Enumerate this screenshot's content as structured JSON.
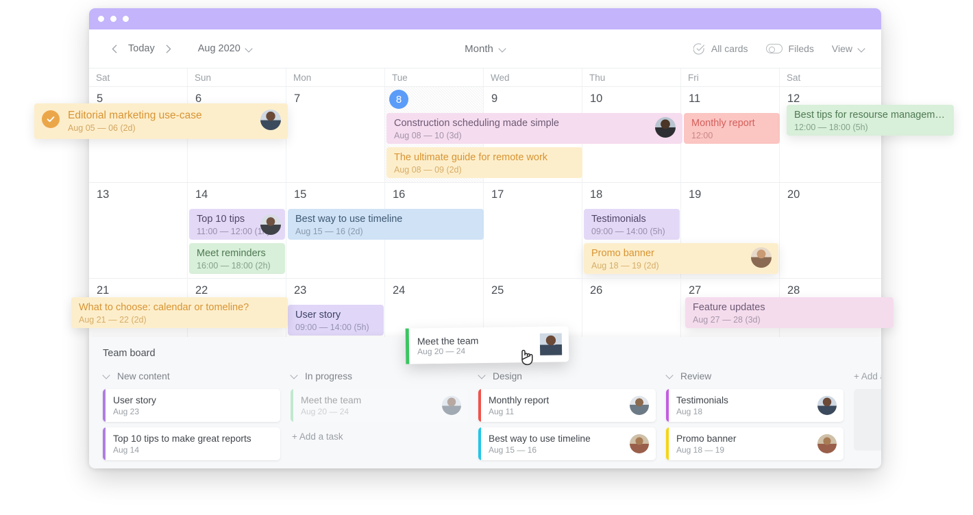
{
  "window": {
    "dots": 3
  },
  "toolbar": {
    "prev_label": "‹",
    "today_label": "Today",
    "next_label": "›",
    "month_label": "Aug 2020",
    "view_label": "Month",
    "all_cards_label": "All cards",
    "fields_label": "Fileds",
    "view_menu_label": "View"
  },
  "calendar": {
    "daynames": [
      "Sat",
      "Sun",
      "Mon",
      "Tue",
      "Wed",
      "Thu",
      "Fri",
      "Sat"
    ],
    "today_day": "8",
    "weeks": [
      {
        "days": [
          "5",
          "6",
          "7",
          "8",
          "9",
          "10",
          "11",
          "12"
        ]
      },
      {
        "days": [
          "13",
          "14",
          "15",
          "16",
          "17",
          "18",
          "19",
          "20"
        ]
      },
      {
        "days": [
          "21",
          "22",
          "23",
          "24",
          "25",
          "26",
          "27",
          "28"
        ]
      }
    ],
    "events": [
      {
        "id": "editorial",
        "title": "Editorial marketing use-case",
        "meta": "Aug 05 — 06 (2d)",
        "color": "#fdeecb",
        "done": true,
        "avatar": true
      },
      {
        "id": "construction",
        "title": "Construction scheduling made simple",
        "meta": "Aug 08 — 10 (3d)",
        "color": "#f6dcef",
        "done": false,
        "avatar": true
      },
      {
        "id": "ultimate",
        "title": "The ultimate guide for remote work",
        "meta": "Aug 08 — 09 (2d)",
        "color": "#fdeecb",
        "done": false,
        "avatar": false
      },
      {
        "id": "monthly",
        "title": "Monthly report",
        "meta": "12:00",
        "color": "#fbc5c2",
        "done": false,
        "avatar": false
      },
      {
        "id": "besttips",
        "title": "Best tips for resourse management",
        "meta": "12:00 — 18:00 (5h)",
        "color": "#d8efd9",
        "done": false,
        "avatar": false
      },
      {
        "id": "top10",
        "title": "Top 10 tips",
        "meta": "11:00 — 12:00 (1h)",
        "color": "#e3d9f7",
        "done": false,
        "avatar": true
      },
      {
        "id": "meetrem",
        "title": "Meet reminders",
        "meta": "16:00 — 18:00 (2h)",
        "color": "#d8efd9",
        "done": false,
        "avatar": false
      },
      {
        "id": "bestway",
        "title": "Best way to use timeline",
        "meta": "Aug 15 — 16 (2d)",
        "color": "#cfe2f6",
        "done": false,
        "avatar": false
      },
      {
        "id": "testimonials",
        "title": "Testimonials",
        "meta": "09:00 — 14:00 (5h)",
        "color": "#e3d9f7",
        "done": false,
        "avatar": false
      },
      {
        "id": "promo",
        "title": "Promo banner",
        "meta": "Aug 18  — 19 (2d)",
        "color": "#fdeecb",
        "done": false,
        "avatar": true
      },
      {
        "id": "whatchoose",
        "title": "What to choose: calendar or tomeline?",
        "meta": "Aug 21 — 22 (2d)",
        "color": "#fdeecb",
        "done": false,
        "avatar": false
      },
      {
        "id": "userstory",
        "title": "User story",
        "meta": "09:00 — 14:00 (5h)",
        "color": "#e0d6f7",
        "done": false,
        "avatar": false
      },
      {
        "id": "feature",
        "title": "Feature updates",
        "meta": "Aug 27 — 28 (3d)",
        "color": "#f5dced",
        "done": false,
        "avatar": false
      }
    ]
  },
  "drag_card": {
    "title": "Meet the team",
    "meta": "Aug 20 — 24",
    "accent": "#3cc562"
  },
  "board": {
    "title": "Team board",
    "add_list_label": "+ Add a list",
    "columns": [
      {
        "name": "New content",
        "add_task_label": null,
        "cards": [
          {
            "title": "User story",
            "meta": "Aug 23",
            "accent": "#b07de0",
            "avatar": false,
            "ghost": false
          },
          {
            "title": "Top 10 tips to make great reports",
            "meta": "Aug 14",
            "accent": "#b07de0",
            "avatar": false,
            "ghost": false
          }
        ]
      },
      {
        "name": "In progress",
        "add_task_label": "+ Add a task",
        "cards": [
          {
            "title": "Meet the team",
            "meta": "Aug 20 — 24",
            "accent": "#7ed99a",
            "avatar": true,
            "ghost": true
          }
        ]
      },
      {
        "name": "Design",
        "add_task_label": null,
        "cards": [
          {
            "title": "Monthly report",
            "meta": "Aug 11",
            "accent": "#f1524a",
            "avatar": true,
            "ghost": false
          },
          {
            "title": "Best way to use timeline",
            "meta": "Aug 15 — 16",
            "accent": "#22c6e8",
            "avatar": true,
            "ghost": false
          }
        ]
      },
      {
        "name": "Review",
        "add_task_label": null,
        "cards": [
          {
            "title": "Testimonials",
            "meta": "Aug 18",
            "accent": "#c45de0",
            "avatar": true,
            "ghost": false
          },
          {
            "title": "Promo banner",
            "meta": "Aug 18 — 19",
            "accent": "#f4d613",
            "avatar": true,
            "ghost": false
          }
        ]
      }
    ]
  },
  "colors": {
    "titlebar": "#c3b4fb",
    "today_badge": "#5a9cf8",
    "check_badge": "#eba64a"
  }
}
